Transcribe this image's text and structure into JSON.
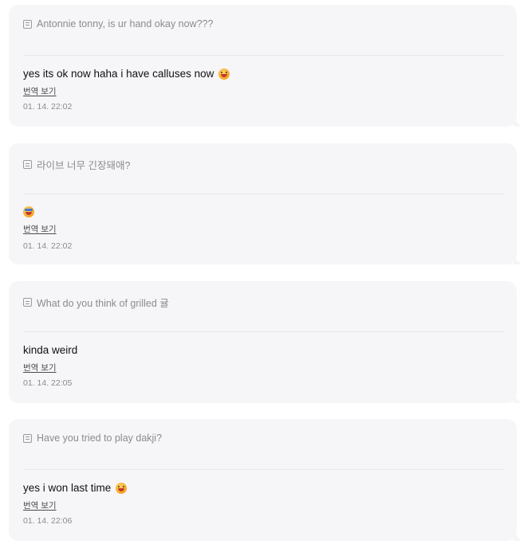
{
  "translate_label": "번역 보기",
  "posts": [
    {
      "question": "Antonnie tonny, is ur hand okay now???",
      "answer": "yes its ok now haha i have calluses now",
      "emoji": "face-savoring-food-emoji",
      "time": "01. 14. 22:02"
    },
    {
      "question": "라이브 너무 긴장돼애?",
      "answer": "",
      "emoji": "smiling-face-with-sunglasses-emoji",
      "time": "01. 14. 22:02"
    },
    {
      "question": "What do you think of grilled 귤",
      "answer": "kinda weird",
      "emoji": "",
      "time": "01. 14. 22:05"
    },
    {
      "question": "Have you tried to play dakji?",
      "answer": "yes i won last time",
      "emoji": "grinning-face-emoji",
      "time": "01. 14. 22:06"
    }
  ]
}
